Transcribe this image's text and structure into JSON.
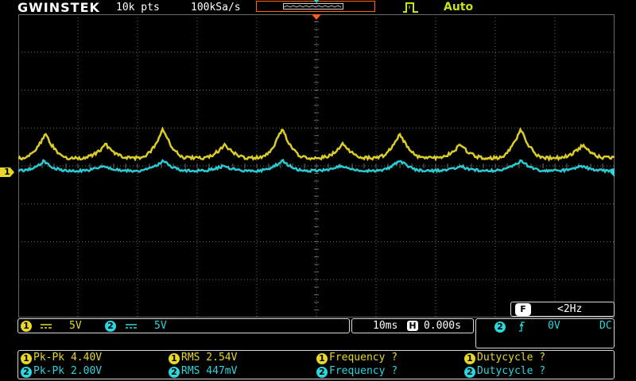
{
  "header": {
    "brand": "GWINSTEK",
    "record_length": "10k pts",
    "sample_rate": "100kSa/s",
    "trigger_mode": "Auto",
    "trigger_icon": "rising-edge-pulse-icon"
  },
  "channels": [
    {
      "id": "1",
      "coupling_icon": "dc-coupling-icon",
      "scale": "5V",
      "color": "#e7d829"
    },
    {
      "id": "2",
      "coupling_icon": "dc-coupling-icon",
      "scale": "5V",
      "color": "#2cd6de"
    }
  ],
  "timebase": {
    "scale": "10ms",
    "icon": "H",
    "position": "0.000s"
  },
  "trigger": {
    "source": "2",
    "slope_icon": "rising-slope-icon",
    "level": "0V",
    "coupling": "DC"
  },
  "frequency_counter": {
    "icon": "F",
    "value": "<2Hz"
  },
  "ch1_marker": "1",
  "measurements": [
    {
      "channel": "1",
      "items": [
        "Pk-Pk 4.40V",
        "RMS 2.54V",
        "Frequency ?",
        "Dutycycle ?"
      ]
    },
    {
      "channel": "2",
      "items": [
        "Pk-Pk 2.00V",
        "RMS 447mV",
        "Frequency ?",
        "Dutycycle ?"
      ]
    }
  ],
  "colors": {
    "ch1": "#e7d829",
    "ch2": "#2cd6de",
    "grid": "#6a6a6a",
    "accent": "#ff6a00",
    "trigger": "#c8e21a"
  }
}
